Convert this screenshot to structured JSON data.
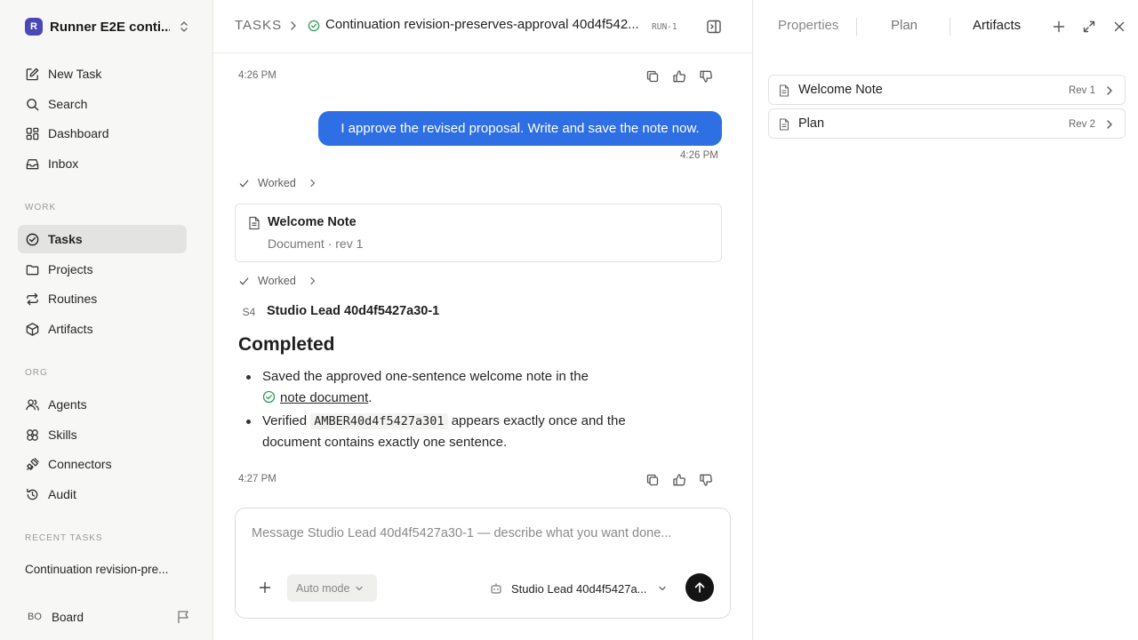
{
  "sidebar": {
    "workspace": {
      "logo": "R",
      "name": "Runner E2E conti..."
    },
    "top_items": [
      {
        "label": "New Task",
        "icon": "edit-icon"
      },
      {
        "label": "Search",
        "icon": "search-icon"
      },
      {
        "label": "Dashboard",
        "icon": "dashboard-icon"
      },
      {
        "label": "Inbox",
        "icon": "inbox-icon"
      }
    ],
    "work_heading": "WORK",
    "work_items": [
      {
        "label": "Tasks",
        "icon": "check-circle-icon",
        "active": true
      },
      {
        "label": "Projects",
        "icon": "folder-icon"
      },
      {
        "label": "Routines",
        "icon": "repeat-icon"
      },
      {
        "label": "Artifacts",
        "icon": "box-icon"
      }
    ],
    "org_heading": "ORG",
    "org_items": [
      {
        "label": "Agents",
        "icon": "users-icon"
      },
      {
        "label": "Skills",
        "icon": "skills-icon"
      },
      {
        "label": "Connectors",
        "icon": "plug-icon"
      },
      {
        "label": "Audit",
        "icon": "history-icon"
      }
    ],
    "recent_heading": "RECENT TASKS",
    "recent_items": [
      {
        "label": "Continuation revision-pre..."
      }
    ],
    "user": {
      "initials": "BO",
      "name": "Board"
    }
  },
  "header": {
    "root": "TASKS",
    "title": "Continuation revision-preserves-approval 40d4f542...",
    "run_id": "RUN-1"
  },
  "chat": {
    "ts1": "4:26 PM",
    "user_message": "I approve the revised proposal. Write and save the note now.",
    "ts_user": "4:26 PM",
    "worked_label": "Worked",
    "doc_card": {
      "title": "Welcome Note",
      "subtitle": "Document · rev 1"
    },
    "agent_badge": "S4",
    "agent_name": "Studio Lead 40d4f5427a30-1",
    "completed_heading": "Completed",
    "bullet1_pre": "Saved the approved one-sentence welcome note in the",
    "bullet1_link": "note document",
    "bullet1_post": ".",
    "bullet2_pre": "Verified",
    "bullet2_code": "AMBER40d4f5427a301",
    "bullet2_post": "appears exactly once and the document contains exactly one sentence.",
    "ts2": "4:27 PM"
  },
  "composer": {
    "placeholder": "Message Studio Lead 40d4f5427a30-1 — describe what you want done...",
    "mode": "Auto mode",
    "agent": "Studio Lead 40d4f5427a..."
  },
  "right_panel": {
    "tabs": [
      {
        "label": "Properties"
      },
      {
        "label": "Plan"
      },
      {
        "label": "Artifacts",
        "active": true
      }
    ],
    "artifacts": [
      {
        "name": "Welcome Note",
        "rev": "Rev 1"
      },
      {
        "name": "Plan",
        "rev": "Rev 2"
      }
    ]
  },
  "colors": {
    "accent": "#2f6fe4",
    "success": "#2e9e57",
    "workspace_logo": "#4a48b6"
  }
}
